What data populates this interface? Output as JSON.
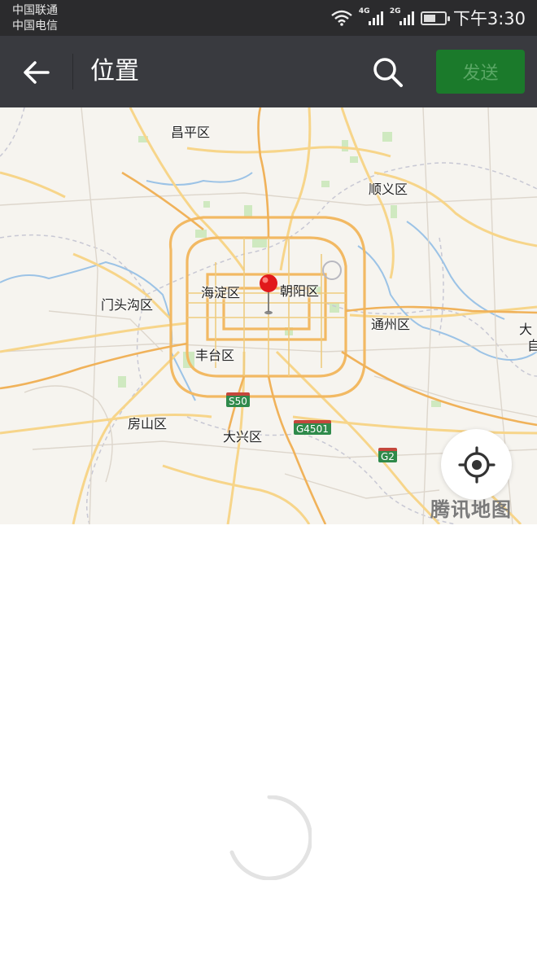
{
  "status_bar": {
    "carriers": [
      "中国联通",
      "中国电信"
    ],
    "signals": [
      {
        "type": "4G",
        "level": 4
      },
      {
        "type": "2G",
        "level": 4
      }
    ],
    "battery_level": 0.6,
    "time": "下午3:30",
    "icons": [
      "wifi-icon",
      "signal-icon",
      "battery-icon"
    ]
  },
  "nav_bar": {
    "title": "位置",
    "back_icon": "arrow-left-icon",
    "search_icon": "search-icon",
    "send_label": "发送",
    "colors": {
      "bar": "#393a3f",
      "send_bg": "#1b7a2b",
      "send_text": "#5aa765"
    }
  },
  "map": {
    "districts": {
      "changping": "昌平区",
      "shunyi": "顺义区",
      "haidian": "海淀区",
      "chaoyang": "朝阳区",
      "mentougou": "门头沟区",
      "tongzhou": "通州区",
      "fengtai": "丰台区",
      "fangshan": "房山区",
      "daxing": "大兴区",
      "edge_top": "大",
      "edge_bottom": "自"
    },
    "highways": {
      "s50": "S50",
      "g4501": "G4501",
      "g2": "G2"
    },
    "brand": "腾讯地图",
    "locate_icon": "crosshair-locate-icon",
    "pin_icon": "map-pin-icon"
  },
  "loading": {
    "icon": "loading-spinner-icon"
  }
}
